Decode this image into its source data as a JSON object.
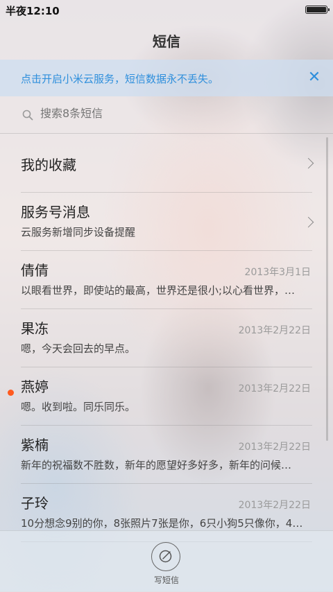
{
  "status": {
    "time": "半夜12:10"
  },
  "header": {
    "title": "短信"
  },
  "banner": {
    "text": "点击开启小米云服务，短信数据永不丢失。",
    "close": "✕"
  },
  "search": {
    "placeholder": "搜索8条短信"
  },
  "list": [
    {
      "name": "我的收藏",
      "sub": "",
      "date": "",
      "chevron": true,
      "unread": false
    },
    {
      "name": "服务号消息",
      "sub": "云服务新增同步设备提醒",
      "date": "",
      "chevron": true,
      "unread": false
    },
    {
      "name": "倩倩",
      "sub": "以眼看世界，即使站的最高，世界还是很小;以心看世界，…",
      "date": "2013年3月1日",
      "chevron": false,
      "unread": false
    },
    {
      "name": "果冻",
      "sub": "嗯，今天会回去的早点。",
      "date": "2013年2月22日",
      "chevron": false,
      "unread": false
    },
    {
      "name": "燕婷",
      "sub": "嗯。收到啦。同乐同乐。",
      "date": "2013年2月22日",
      "chevron": false,
      "unread": true
    },
    {
      "name": "紫楠",
      "sub": "新年的祝福数不胜数，新年的愿望好多好多，新年的问候…",
      "date": "2013年2月22日",
      "chevron": false,
      "unread": false
    },
    {
      "name": "子玲",
      "sub": "10分想念9别的你，8张照片7张是你，6只小狗5只像你，4…",
      "date": "2013年2月22日",
      "chevron": false,
      "unread": false
    }
  ],
  "bottom": {
    "compose_label": "写短信"
  },
  "colors": {
    "accent": "#2f8fdc",
    "unread": "#ff5a1f"
  }
}
